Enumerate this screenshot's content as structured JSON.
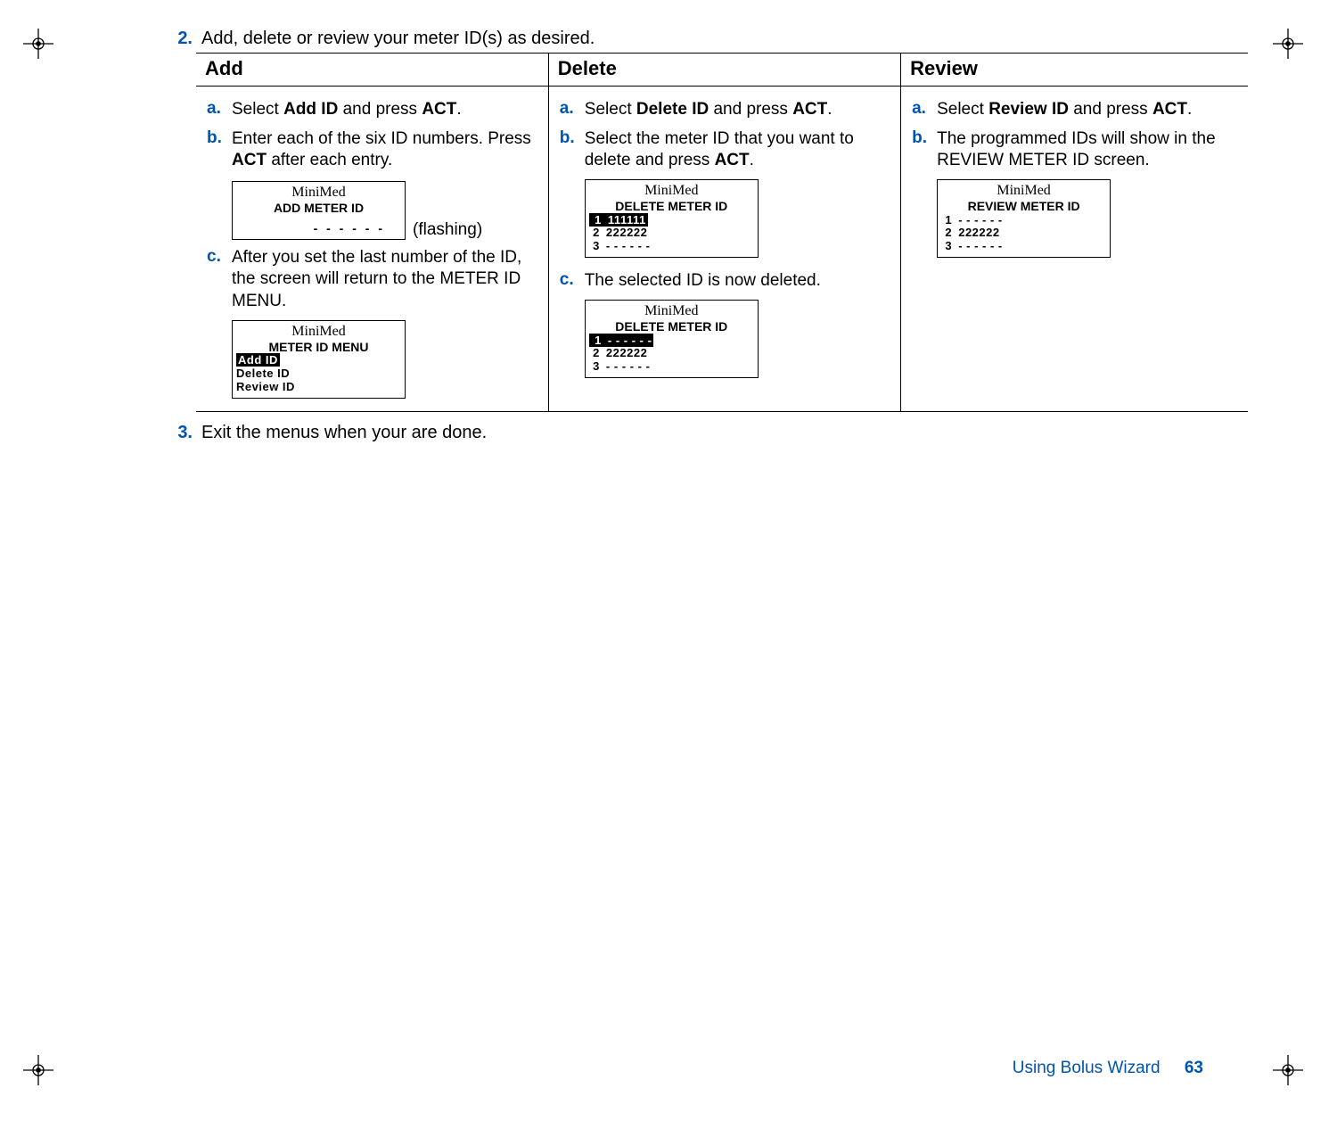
{
  "steps": {
    "s2_num": "2.",
    "s2_text": "Add, delete or review your meter ID(s) as desired.",
    "s3_num": "3.",
    "s3_text": "Exit the menus when your are done."
  },
  "headers": {
    "add": "Add",
    "delete": "Delete",
    "review": "Review"
  },
  "add": {
    "a_letter": "a.",
    "a_pre": "Select ",
    "a_bold1": "Add ID",
    "a_mid": " and press ",
    "a_bold2": "ACT",
    "a_post": ".",
    "b_letter": "b.",
    "b_pre": "Enter each of the six ID numbers. Press ",
    "b_bold": "ACT",
    "b_post": " after each entry.",
    "flash_brand": "MiniMed",
    "flash_title": "ADD METER ID",
    "flash_dashes": "- - - - - -",
    "flash_note": "(flashing)",
    "c_letter": "c.",
    "c_text": "After you set the last number of the ID, the screen will return to the METER ID MENU.",
    "menu_brand": "MiniMed",
    "menu_title": "METER ID MENU",
    "menu_hl": "Add ID",
    "menu_l2": "Delete ID",
    "menu_l3": "Review ID"
  },
  "del": {
    "a_letter": "a.",
    "a_pre": "Select ",
    "a_bold1": "Delete ID",
    "a_mid": " and press ",
    "a_bold2": "ACT",
    "a_post": ".",
    "b_letter": "b.",
    "b_pre": "Select the meter ID that you want to delete and press ",
    "b_bold": "ACT",
    "b_post": ".",
    "s1_brand": "MiniMed",
    "s1_title": "DELETE METER ID",
    "s1_r1_num": "1",
    "s1_r1_val": "111111",
    "s1_r2_num": "2",
    "s1_r2_val": "222222",
    "s1_r3_num": "3",
    "s1_r3_val": "- - - - - -",
    "c_letter": "c.",
    "c_text": "The selected ID is now deleted.",
    "s2_brand": "MiniMed",
    "s2_title": "DELETE METER ID",
    "s2_r1_num": "1",
    "s2_r1_val": "- - - - - -",
    "s2_r2_num": "2",
    "s2_r2_val": "222222",
    "s2_r3_num": "3",
    "s2_r3_val": "- - - - - -"
  },
  "rev": {
    "a_letter": "a.",
    "a_pre": "Select ",
    "a_bold1": "Review ID",
    "a_mid": " and press ",
    "a_bold2": "ACT",
    "a_post": ".",
    "b_letter": "b.",
    "b_text": "The programmed IDs will show in the REVIEW METER ID screen.",
    "s_brand": "MiniMed",
    "s_title": "REVIEW METER ID",
    "s_r1_num": "1",
    "s_r1_val": "- - - - - -",
    "s_r2_num": "2",
    "s_r2_val": "222222",
    "s_r3_num": "3",
    "s_r3_val": "- - - - - -"
  },
  "footer": {
    "chapter": "Using Bolus Wizard",
    "page": "63"
  }
}
